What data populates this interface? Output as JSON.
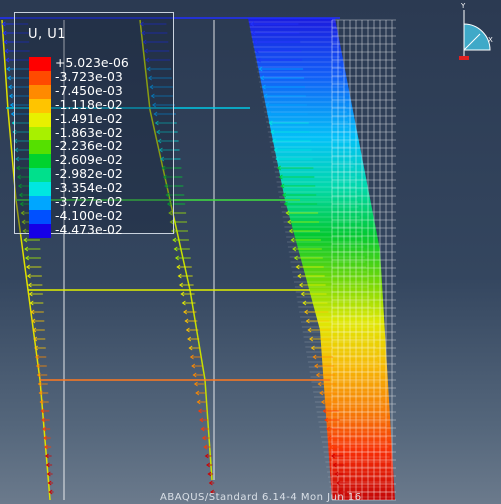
{
  "legend": {
    "title": "U, U1",
    "entries": [
      {
        "label": "+5.023e-06",
        "color": "#ff0000"
      },
      {
        "label": "-3.723e-03",
        "color": "#ff4a00"
      },
      {
        "label": "-7.450e-03",
        "color": "#ff8a00"
      },
      {
        "label": "-1.118e-02",
        "color": "#ffc400"
      },
      {
        "label": "-1.491e-02",
        "color": "#e8f000"
      },
      {
        "label": "-1.863e-02",
        "color": "#a8f000"
      },
      {
        "label": "-2.236e-02",
        "color": "#55e000"
      },
      {
        "label": "-2.609e-02",
        "color": "#00d22e"
      },
      {
        "label": "-2.982e-02",
        "color": "#00e08c"
      },
      {
        "label": "-3.354e-02",
        "color": "#00e6e0"
      },
      {
        "label": "-3.727e-02",
        "color": "#00a6ff"
      },
      {
        "label": "-4.100e-02",
        "color": "#0050ff"
      },
      {
        "label": "-4.473e-02",
        "color": "#1600e6"
      }
    ]
  },
  "triad": {
    "y_label": "Y",
    "x_label": "X"
  },
  "footer": {
    "text": "ABAQUS/Standard 6.14-4 Mon Jun 16"
  }
}
